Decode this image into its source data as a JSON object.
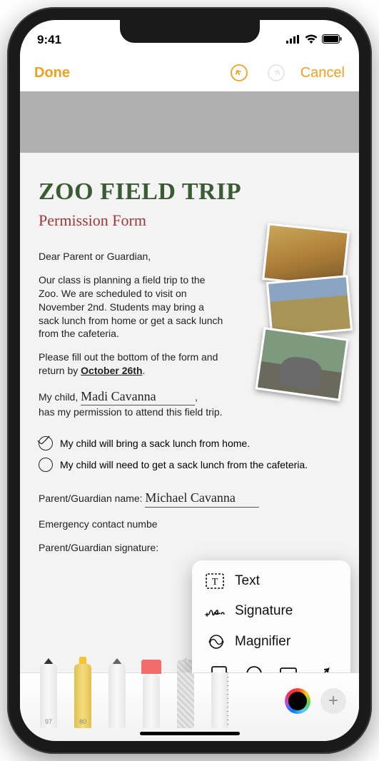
{
  "status_bar": {
    "time": "9:41"
  },
  "nav": {
    "done": "Done",
    "cancel": "Cancel"
  },
  "document": {
    "title": "ZOO FIELD TRIP",
    "subtitle": "Permission Form",
    "greeting": "Dear Parent or Guardian,",
    "para1": "Our class is planning a field trip to the Zoo. We are scheduled to visit on November 2nd. Students may bring a sack lunch from home or get a sack lunch from the cafeteria.",
    "para2a": "Please fill out the bottom of the form and return by ",
    "para2_deadline": "October 26th",
    "child_label": "My child, ",
    "child_name": "Madi Cavanna",
    "child_suffix": "has my permission to attend this field trip.",
    "option1": "My child will bring a sack lunch from home.",
    "option2": "My child will need to get a sack lunch from the cafeteria.",
    "guardian_name_label": "Parent/Guardian name: ",
    "guardian_name": "Michael Cavanna",
    "emergency_label": "Emergency contact numbe",
    "signature_label": "Parent/Guardian signature:"
  },
  "popup": {
    "items": [
      {
        "label": "Text"
      },
      {
        "label": "Signature"
      },
      {
        "label": "Magnifier"
      }
    ]
  },
  "tools": {
    "pen_size": "97",
    "marker_size": "80"
  }
}
